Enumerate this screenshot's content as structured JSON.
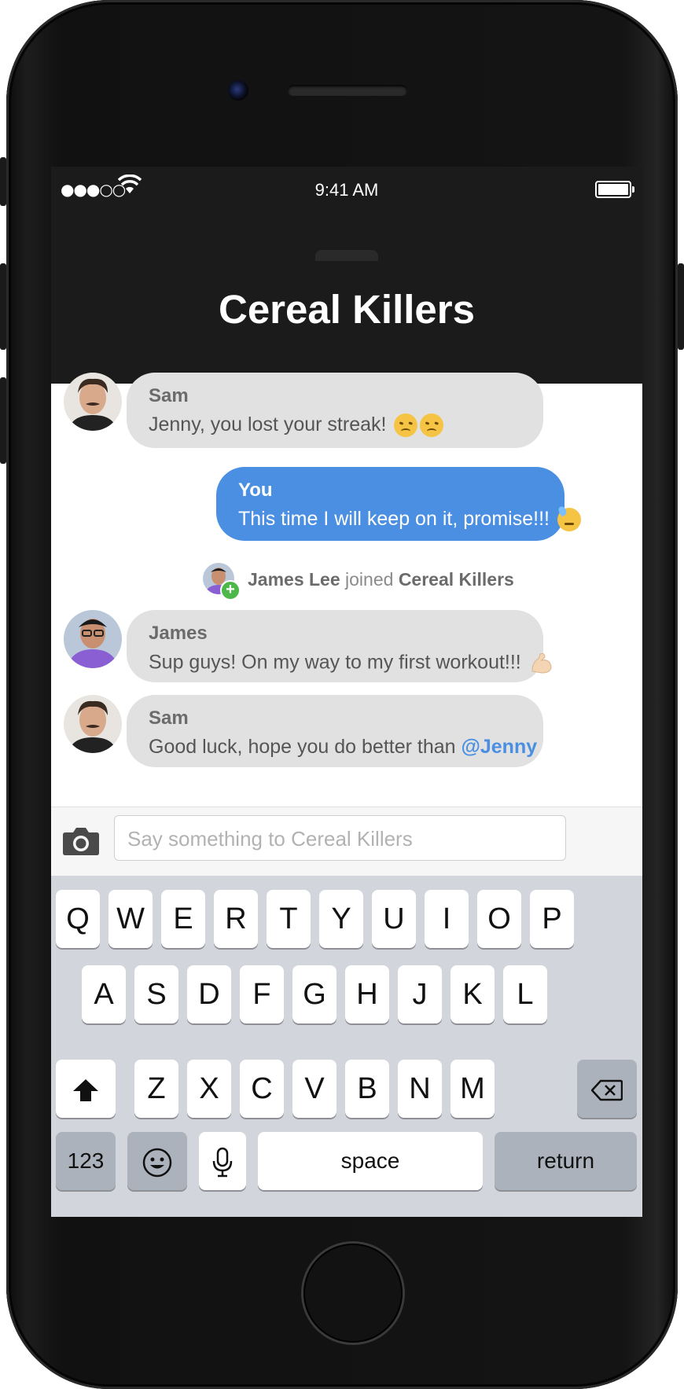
{
  "status_bar": {
    "signal": "●●●○○",
    "time": "9:41 AM",
    "battery": "battery-full"
  },
  "header": {
    "title": "Cereal Killers"
  },
  "messages": [
    {
      "sender": "Sam",
      "text": "Jenny, you lost your streak! ",
      "emojis": [
        "disappointed-face",
        "disappointed-face"
      ],
      "mine": false
    },
    {
      "sender": "You",
      "text": "This time I will keep on it, promise!!! ",
      "emojis": [
        "sweat-face"
      ],
      "mine": true
    },
    {
      "sender": "James",
      "text": "Sup guys! On my way to my first workout!!! ",
      "emojis": [
        "flexed-biceps"
      ],
      "mine": false
    },
    {
      "sender": "Sam",
      "text": "Good luck, hope you do better than ",
      "mention": "@Jenny",
      "mine": false
    }
  ],
  "system_event": {
    "user": "James Lee",
    "action": " joined ",
    "group": "Cereal Killers"
  },
  "composer": {
    "placeholder": "Say something to Cereal Killers",
    "camera_icon": "camera-icon"
  },
  "keyboard": {
    "row1": [
      "Q",
      "W",
      "E",
      "R",
      "T",
      "Y",
      "U",
      "I",
      "O",
      "P"
    ],
    "row2": [
      "A",
      "S",
      "D",
      "F",
      "G",
      "H",
      "J",
      "K",
      "L"
    ],
    "row3": [
      "Z",
      "X",
      "C",
      "V",
      "B",
      "N",
      "M"
    ],
    "shift_icon": "shift-arrow-icon",
    "delete_icon": "backspace-icon",
    "numbers_label": "123",
    "emoji_icon": "emoji-face-icon",
    "mic_icon": "microphone-icon",
    "space_label": "space",
    "return_label": "return"
  },
  "colors": {
    "accent": "#4a8fe2",
    "bubble": "#e1e1e1",
    "nav": "#1b1b1b",
    "join_badge": "#4cb849"
  }
}
